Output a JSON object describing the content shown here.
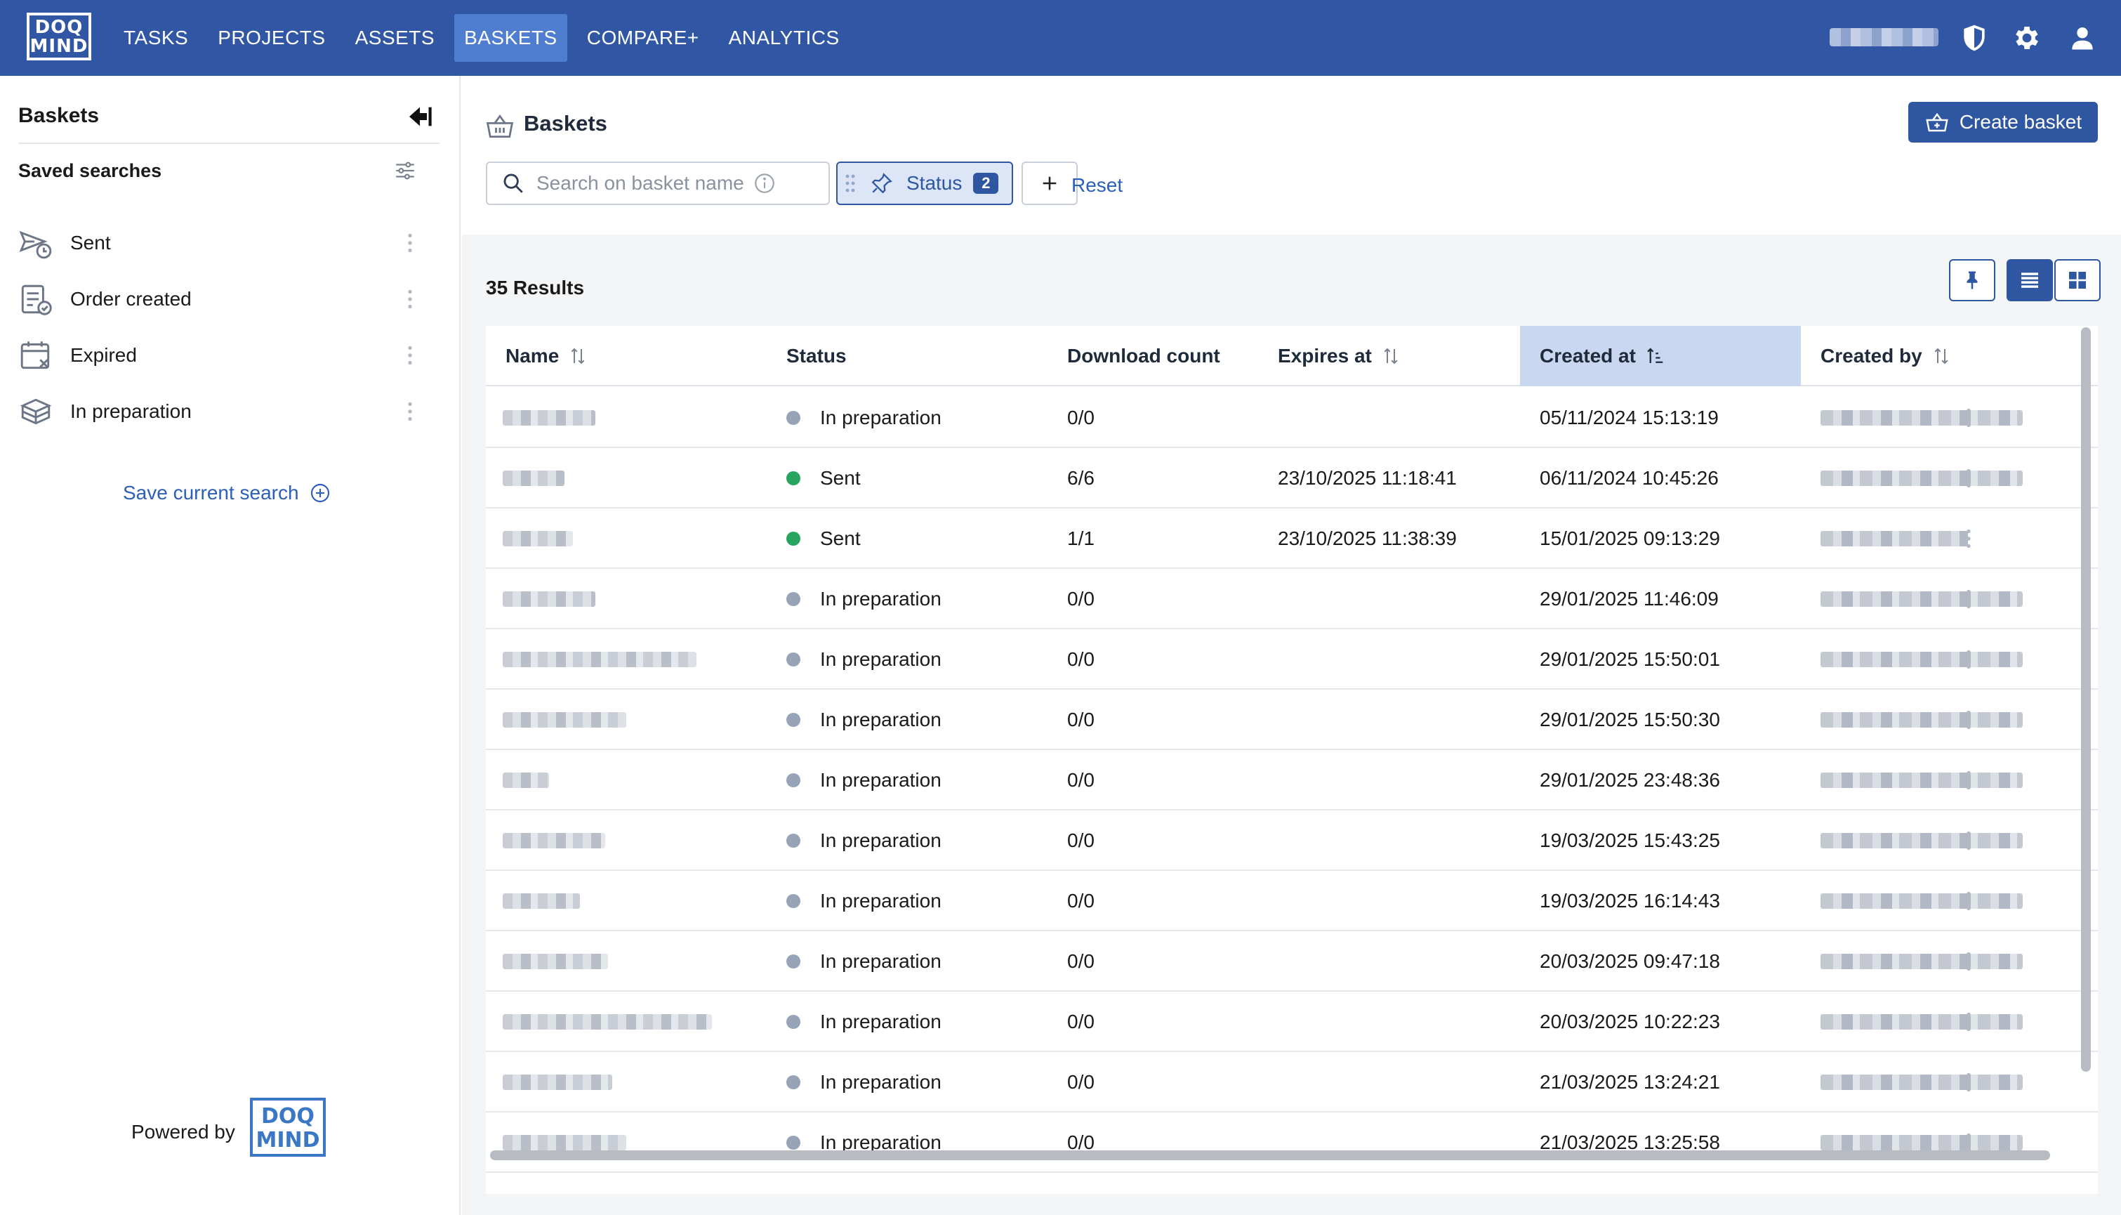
{
  "app": {
    "logo_text_line1": "DOQ",
    "logo_text_line2": "MIND",
    "nav": [
      {
        "label": "TASKS",
        "active": false
      },
      {
        "label": "PROJECTS",
        "active": false
      },
      {
        "label": "ASSETS",
        "active": false
      },
      {
        "label": "BASKETS",
        "active": true
      },
      {
        "label": "COMPARE+",
        "active": false
      },
      {
        "label": "ANALYTICS",
        "active": false
      }
    ],
    "icons": [
      "shield-icon",
      "gear-icon",
      "user-icon"
    ],
    "colors": {
      "topbar": "#3157a4",
      "accent": "#2e56a1",
      "link": "#2c5fb8",
      "sent": "#25a55f",
      "prep": "#97a3b6"
    }
  },
  "sidebar": {
    "title": "Baskets",
    "saved_title": "Saved searches",
    "items": [
      {
        "label": "Sent",
        "icon": "sent-clock-icon"
      },
      {
        "label": "Order created",
        "icon": "order-created-icon"
      },
      {
        "label": "Expired",
        "icon": "calendar-expired-icon"
      },
      {
        "label": "In preparation",
        "icon": "box-preparation-icon"
      }
    ],
    "save_label": "Save current search",
    "powered_by": "Powered by",
    "powered_logo_line1": "DOQ",
    "powered_logo_line2": "MIND"
  },
  "main": {
    "title": "Baskets",
    "create_label": "Create basket",
    "search_placeholder": "Search on basket name",
    "status_filter_label": "Status",
    "status_filter_count": "2",
    "reset_label": "Reset",
    "results_label": "35 Results"
  },
  "table": {
    "columns": [
      "Name",
      "Status",
      "Download count",
      "Expires at",
      "Created at",
      "Created by"
    ],
    "sorted_column": "Created at",
    "rows": [
      {
        "status": "In preparation",
        "status_type": "prep",
        "download": "0/0",
        "expires": "",
        "created": "05/11/2024 15:13:19"
      },
      {
        "status": "Sent",
        "status_type": "sent",
        "download": "6/6",
        "expires": "23/10/2025 11:18:41",
        "created": "06/11/2024 10:45:26"
      },
      {
        "status": "Sent",
        "status_type": "sent",
        "download": "1/1",
        "expires": "23/10/2025 11:38:39",
        "created": "15/01/2025 09:13:29"
      },
      {
        "status": "In preparation",
        "status_type": "prep",
        "download": "0/0",
        "expires": "",
        "created": "29/01/2025 11:46:09"
      },
      {
        "status": "In preparation",
        "status_type": "prep",
        "download": "0/0",
        "expires": "",
        "created": "29/01/2025 15:50:01"
      },
      {
        "status": "In preparation",
        "status_type": "prep",
        "download": "0/0",
        "expires": "",
        "created": "29/01/2025 15:50:30"
      },
      {
        "status": "In preparation",
        "status_type": "prep",
        "download": "0/0",
        "expires": "",
        "created": "29/01/2025 23:48:36"
      },
      {
        "status": "In preparation",
        "status_type": "prep",
        "download": "0/0",
        "expires": "",
        "created": "19/03/2025 15:43:25"
      },
      {
        "status": "In preparation",
        "status_type": "prep",
        "download": "0/0",
        "expires": "",
        "created": "19/03/2025 16:14:43"
      },
      {
        "status": "In preparation",
        "status_type": "prep",
        "download": "0/0",
        "expires": "",
        "created": "20/03/2025 09:47:18"
      },
      {
        "status": "In preparation",
        "status_type": "prep",
        "download": "0/0",
        "expires": "",
        "created": "20/03/2025 10:22:23"
      },
      {
        "status": "In preparation",
        "status_type": "prep",
        "download": "0/0",
        "expires": "",
        "created": "21/03/2025 13:24:21"
      },
      {
        "status": "In preparation",
        "status_type": "prep",
        "download": "0/0",
        "expires": "",
        "created": "21/03/2025 13:25:58"
      }
    ]
  }
}
